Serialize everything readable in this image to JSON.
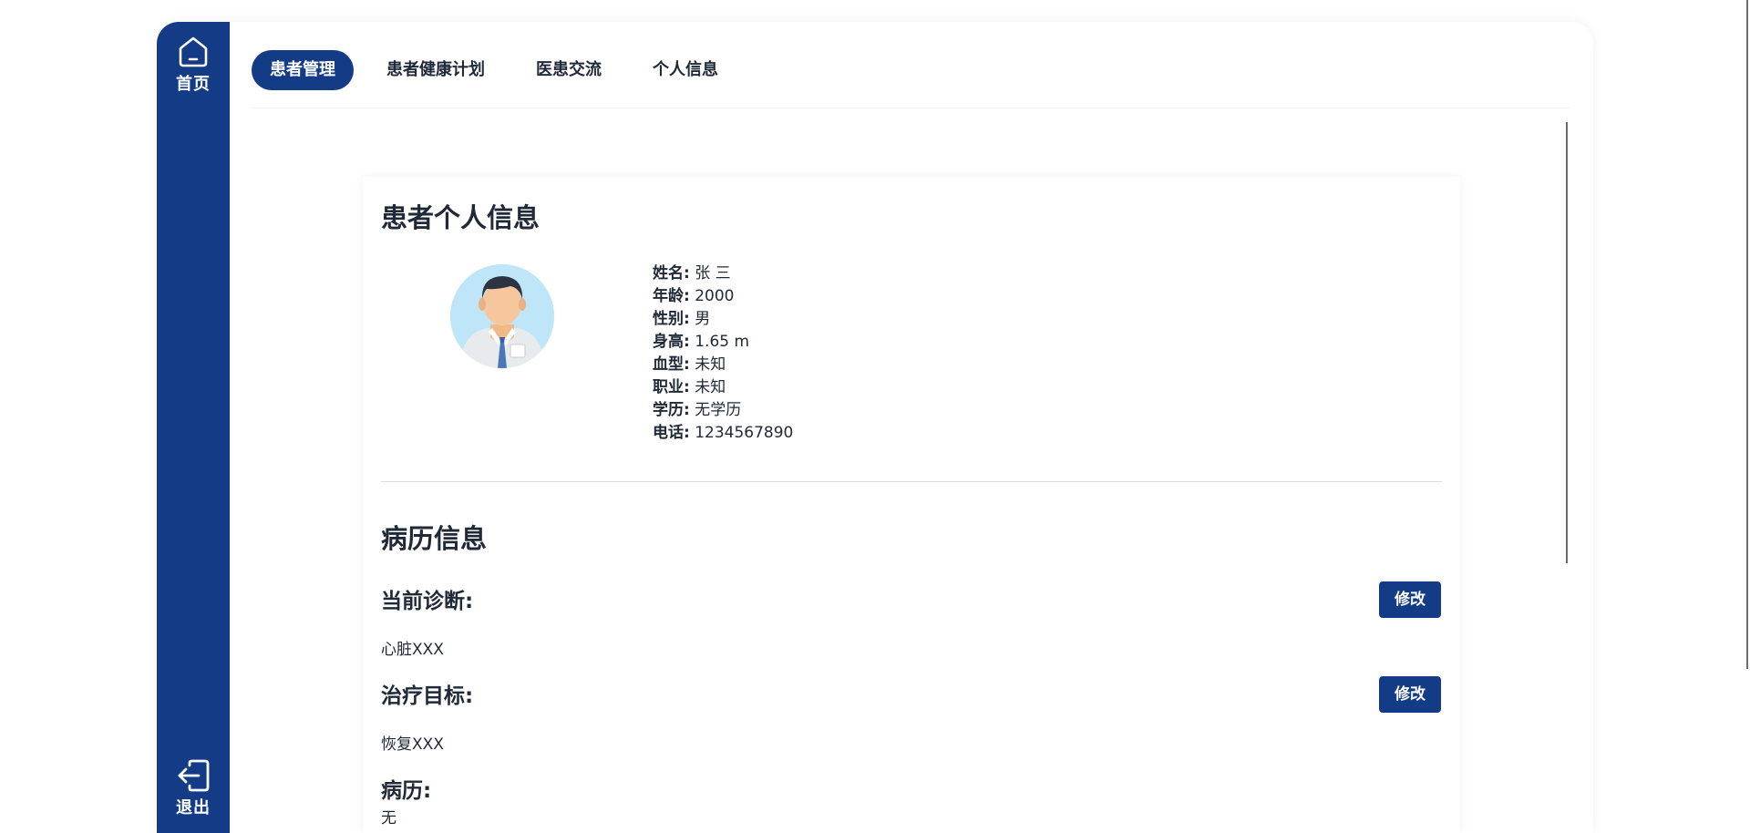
{
  "sidebar": {
    "home_label": "首页",
    "logout_label": "退出"
  },
  "tabs": [
    {
      "label": "患者管理",
      "active": true
    },
    {
      "label": "患者健康计划",
      "active": false
    },
    {
      "label": "医患交流",
      "active": false
    },
    {
      "label": "个人信息",
      "active": false
    }
  ],
  "profile": {
    "title": "患者个人信息",
    "fields": [
      {
        "key": "姓名:",
        "value": "张 三"
      },
      {
        "key": "年龄:",
        "value": "2000"
      },
      {
        "key": "性别:",
        "value": "男"
      },
      {
        "key": "身高:",
        "value": "1.65 m"
      },
      {
        "key": "血型:",
        "value": "未知"
      },
      {
        "key": "职业:",
        "value": "未知"
      },
      {
        "key": "学历:",
        "value": "无学历"
      },
      {
        "key": "电话:",
        "value": "1234567890"
      }
    ]
  },
  "record": {
    "title": "病历信息",
    "diagnosis": {
      "label": "当前诊断:",
      "value": "心脏XXX",
      "edit_label": "修改"
    },
    "goal": {
      "label": "治疗目标:",
      "value": "恢复XXX",
      "edit_label": "修改"
    },
    "history": {
      "label": "病历:",
      "value": "无"
    }
  },
  "colors": {
    "primary": "#143b85",
    "avatar_bg": "#bfe6f8"
  }
}
